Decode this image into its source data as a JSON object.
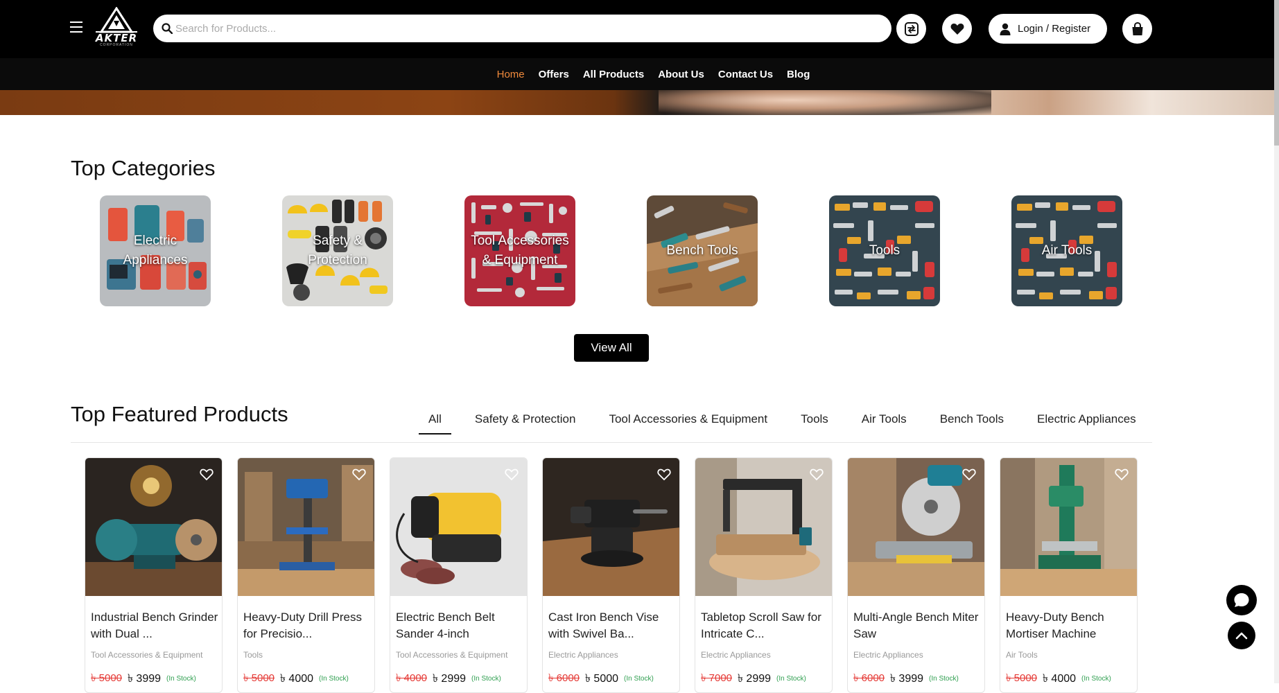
{
  "header": {
    "logo_text": "AKTER",
    "logo_sub": "CORPORATION",
    "search_placeholder": "Search for Products...",
    "login_label": "Login / Register",
    "icons": [
      "menu-icon",
      "search-icon",
      "compare-icon",
      "heart-icon",
      "user-icon",
      "shopping-bag-icon"
    ]
  },
  "nav": {
    "items": [
      "Home",
      "Offers",
      "All Products",
      "About Us",
      "Contact Us",
      "Blog"
    ],
    "active": "Home",
    "active_color": "#f08a3c"
  },
  "categories": {
    "title": "Top Categories",
    "items": [
      {
        "label": "Electric Appliances",
        "color": "#b9bcbf"
      },
      {
        "label": "Safety & Protection",
        "color": "#d9d9d6"
      },
      {
        "label": "Tool Accessories & Equipment",
        "color": "#b3293a"
      },
      {
        "label": "Bench Tools",
        "color": "#8d6a48"
      },
      {
        "label": "Tools",
        "color": "#33454f"
      },
      {
        "label": "Air Tools",
        "color": "#33454f"
      }
    ],
    "view_all": "View All"
  },
  "featured": {
    "title": "Top Featured Products",
    "tabs": [
      "All",
      "Safety & Protection",
      "Tool Accessories & Equipment",
      "Tools",
      "Air Tools",
      "Bench Tools",
      "Electric Appliances"
    ],
    "active_tab": "All",
    "products": [
      {
        "title": "Industrial Bench Grinder with Dual ...",
        "category": "Tool Accessories & Equipment",
        "old_price": "৳ 5000",
        "price": "৳ 3999",
        "stock": "(In Stock)"
      },
      {
        "title": "Heavy-Duty Drill Press for Precisio...",
        "category": "Tools",
        "old_price": "৳ 5000",
        "price": "৳ 4000",
        "stock": "(In Stock)"
      },
      {
        "title": "Electric Bench Belt Sander 4-inch",
        "category": "Tool Accessories & Equipment",
        "old_price": "৳ 4000",
        "price": "৳ 2999",
        "stock": "(In Stock)"
      },
      {
        "title": "Cast Iron Bench Vise with Swivel Ba...",
        "category": "Electric Appliances",
        "old_price": "৳ 6000",
        "price": "৳ 5000",
        "stock": "(In Stock)"
      },
      {
        "title": "Tabletop Scroll Saw for Intricate C...",
        "category": "Electric Appliances",
        "old_price": "৳ 7000",
        "price": "৳ 2999",
        "stock": "(In Stock)"
      },
      {
        "title": "Multi-Angle Bench Miter Saw",
        "category": "Electric Appliances",
        "old_price": "৳ 6000",
        "price": "৳ 3999",
        "stock": "(In Stock)"
      },
      {
        "title": "Heavy-Duty Bench Mortiser Machine",
        "category": "Air Tools",
        "old_price": "৳ 5000",
        "price": "৳ 4000",
        "stock": "(In Stock)"
      }
    ]
  },
  "floating": {
    "icons": [
      "chat-icon",
      "arrow-up-icon"
    ]
  }
}
